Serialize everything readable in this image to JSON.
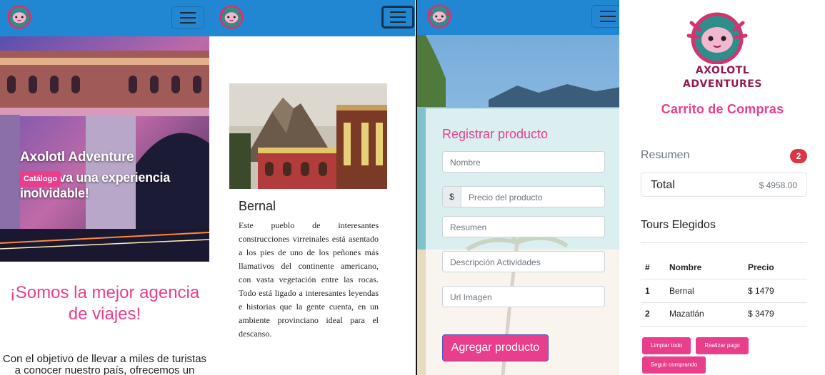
{
  "colors": {
    "navbar": "#2187d2",
    "accent": "#e83e8c",
    "badge": "#dc3545",
    "brand_text": "#8e1a4f"
  },
  "icons": {
    "logo": "axolotl-logo-icon",
    "menu": "hamburger-menu-icon"
  },
  "home": {
    "hero_title": "Axolotl Adventure",
    "hero_subtitle": "¡Reserva una experiencia inolvidable!",
    "catalog_button": "Catálogo",
    "heading": "¡Somos la mejor agencia de viajes!",
    "intro": "Con el objetivo de llevar a miles de turistas a conocer nuestro país, ofrecemos un"
  },
  "tour_card": {
    "title": "Bernal",
    "description": "Este pueblo de interesantes construcciones virreinales está asentado a los pies de uno de los peñones más llamativos del continente americano, con vasta vegetación entre las rocas. Todo está ligado a interesantes leyendas e historias que la gente cuenta, en un ambiente provinciano ideal para el descanso."
  },
  "register_form": {
    "title": "Registrar producto",
    "name_placeholder": "Nombre",
    "currency_prefix": "$",
    "price_placeholder": "Precio del producto",
    "summary_placeholder": "Resumen",
    "activities_placeholder": "Descripción Actividades",
    "image_placeholder": "Url Imagen",
    "submit_label": "Agregar producto"
  },
  "cart": {
    "brand_line1": "AXOLOTL",
    "brand_line2": "ADVENTURES",
    "title": "Carrito de Compras",
    "summary_label": "Resumen",
    "item_count": "2",
    "total_label": "Total",
    "total_value": "$ 4958.00",
    "tours_heading": "Tours Elegidos",
    "columns": [
      "#",
      "Nombre",
      "Precio"
    ],
    "rows": [
      {
        "num": "1",
        "name": "Bernal",
        "price": "$ 1479"
      },
      {
        "num": "2",
        "name": "Mazatlán",
        "price": "$ 3479"
      }
    ],
    "clear_button": "Limpiar todo",
    "pay_button": "Realizar pago",
    "continue_button": "Seguir comprando"
  }
}
